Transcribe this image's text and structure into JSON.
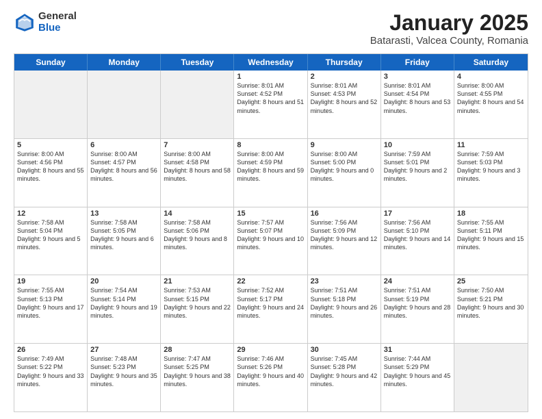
{
  "logo": {
    "general": "General",
    "blue": "Blue"
  },
  "title": "January 2025",
  "subtitle": "Batarasti, Valcea County, Romania",
  "header_days": [
    "Sunday",
    "Monday",
    "Tuesday",
    "Wednesday",
    "Thursday",
    "Friday",
    "Saturday"
  ],
  "weeks": [
    [
      {
        "day": "",
        "text": "",
        "shade": true
      },
      {
        "day": "",
        "text": "",
        "shade": true
      },
      {
        "day": "",
        "text": "",
        "shade": true
      },
      {
        "day": "1",
        "text": "Sunrise: 8:01 AM\nSunset: 4:52 PM\nDaylight: 8 hours and 51 minutes."
      },
      {
        "day": "2",
        "text": "Sunrise: 8:01 AM\nSunset: 4:53 PM\nDaylight: 8 hours and 52 minutes."
      },
      {
        "day": "3",
        "text": "Sunrise: 8:01 AM\nSunset: 4:54 PM\nDaylight: 8 hours and 53 minutes."
      },
      {
        "day": "4",
        "text": "Sunrise: 8:00 AM\nSunset: 4:55 PM\nDaylight: 8 hours and 54 minutes."
      }
    ],
    [
      {
        "day": "5",
        "text": "Sunrise: 8:00 AM\nSunset: 4:56 PM\nDaylight: 8 hours and 55 minutes."
      },
      {
        "day": "6",
        "text": "Sunrise: 8:00 AM\nSunset: 4:57 PM\nDaylight: 8 hours and 56 minutes."
      },
      {
        "day": "7",
        "text": "Sunrise: 8:00 AM\nSunset: 4:58 PM\nDaylight: 8 hours and 58 minutes."
      },
      {
        "day": "8",
        "text": "Sunrise: 8:00 AM\nSunset: 4:59 PM\nDaylight: 8 hours and 59 minutes."
      },
      {
        "day": "9",
        "text": "Sunrise: 8:00 AM\nSunset: 5:00 PM\nDaylight: 9 hours and 0 minutes."
      },
      {
        "day": "10",
        "text": "Sunrise: 7:59 AM\nSunset: 5:01 PM\nDaylight: 9 hours and 2 minutes."
      },
      {
        "day": "11",
        "text": "Sunrise: 7:59 AM\nSunset: 5:03 PM\nDaylight: 9 hours and 3 minutes."
      }
    ],
    [
      {
        "day": "12",
        "text": "Sunrise: 7:58 AM\nSunset: 5:04 PM\nDaylight: 9 hours and 5 minutes."
      },
      {
        "day": "13",
        "text": "Sunrise: 7:58 AM\nSunset: 5:05 PM\nDaylight: 9 hours and 6 minutes."
      },
      {
        "day": "14",
        "text": "Sunrise: 7:58 AM\nSunset: 5:06 PM\nDaylight: 9 hours and 8 minutes."
      },
      {
        "day": "15",
        "text": "Sunrise: 7:57 AM\nSunset: 5:07 PM\nDaylight: 9 hours and 10 minutes."
      },
      {
        "day": "16",
        "text": "Sunrise: 7:56 AM\nSunset: 5:09 PM\nDaylight: 9 hours and 12 minutes."
      },
      {
        "day": "17",
        "text": "Sunrise: 7:56 AM\nSunset: 5:10 PM\nDaylight: 9 hours and 14 minutes."
      },
      {
        "day": "18",
        "text": "Sunrise: 7:55 AM\nSunset: 5:11 PM\nDaylight: 9 hours and 15 minutes."
      }
    ],
    [
      {
        "day": "19",
        "text": "Sunrise: 7:55 AM\nSunset: 5:13 PM\nDaylight: 9 hours and 17 minutes."
      },
      {
        "day": "20",
        "text": "Sunrise: 7:54 AM\nSunset: 5:14 PM\nDaylight: 9 hours and 19 minutes."
      },
      {
        "day": "21",
        "text": "Sunrise: 7:53 AM\nSunset: 5:15 PM\nDaylight: 9 hours and 22 minutes."
      },
      {
        "day": "22",
        "text": "Sunrise: 7:52 AM\nSunset: 5:17 PM\nDaylight: 9 hours and 24 minutes."
      },
      {
        "day": "23",
        "text": "Sunrise: 7:51 AM\nSunset: 5:18 PM\nDaylight: 9 hours and 26 minutes."
      },
      {
        "day": "24",
        "text": "Sunrise: 7:51 AM\nSunset: 5:19 PM\nDaylight: 9 hours and 28 minutes."
      },
      {
        "day": "25",
        "text": "Sunrise: 7:50 AM\nSunset: 5:21 PM\nDaylight: 9 hours and 30 minutes."
      }
    ],
    [
      {
        "day": "26",
        "text": "Sunrise: 7:49 AM\nSunset: 5:22 PM\nDaylight: 9 hours and 33 minutes."
      },
      {
        "day": "27",
        "text": "Sunrise: 7:48 AM\nSunset: 5:23 PM\nDaylight: 9 hours and 35 minutes."
      },
      {
        "day": "28",
        "text": "Sunrise: 7:47 AM\nSunset: 5:25 PM\nDaylight: 9 hours and 38 minutes."
      },
      {
        "day": "29",
        "text": "Sunrise: 7:46 AM\nSunset: 5:26 PM\nDaylight: 9 hours and 40 minutes."
      },
      {
        "day": "30",
        "text": "Sunrise: 7:45 AM\nSunset: 5:28 PM\nDaylight: 9 hours and 42 minutes."
      },
      {
        "day": "31",
        "text": "Sunrise: 7:44 AM\nSunset: 5:29 PM\nDaylight: 9 hours and 45 minutes."
      },
      {
        "day": "",
        "text": "",
        "shade": true
      }
    ]
  ]
}
